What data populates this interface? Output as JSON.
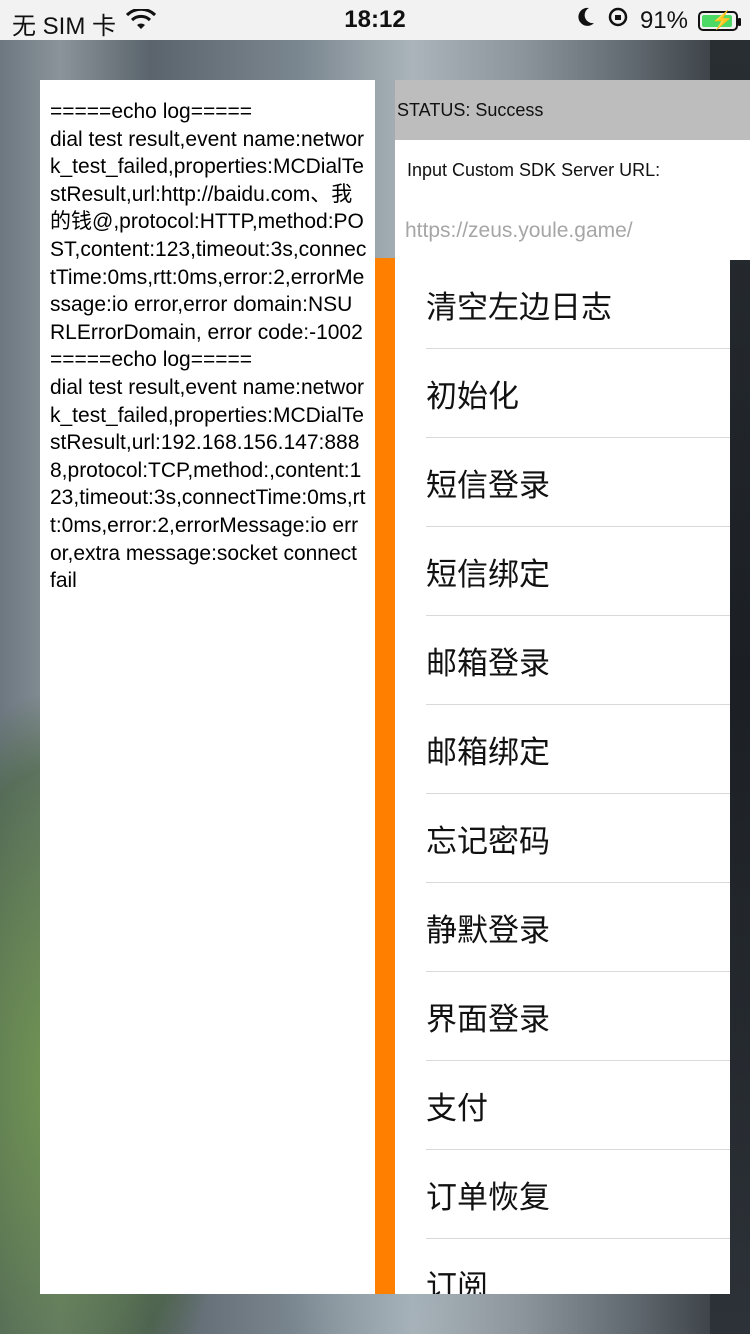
{
  "status_bar": {
    "carrier": "无 SIM 卡",
    "time": "18:12",
    "battery_percent": "91%"
  },
  "log": {
    "text": "=====echo log=====\ndial test result,event name:network_test_failed,properties:MCDialTestResult,url:http://baidu.com、我的钱@,protocol:HTTP,method:POST,content:123,timeout:3s,connectTime:0ms,rtt:0ms,error:2,errorMessage:io error,error domain:NSURLErrorDomain, error code:-1002\n=====echo log=====\ndial test result,event name:network_test_failed,properties:MCDialTestResult,url:192.168.156.147:8888,protocol:TCP,method:,content:123,timeout:3s,connectTime:0ms,rtt:0ms,error:2,errorMessage:io error,extra message:socket connect fail"
  },
  "status": {
    "text": "STATUS: Success"
  },
  "server": {
    "label": "Input Custom SDK Server URL:",
    "placeholder": "https://zeus.youle.game/",
    "value": ""
  },
  "menu": {
    "items": [
      {
        "label": "清空左边日志"
      },
      {
        "label": "初始化"
      },
      {
        "label": "短信登录"
      },
      {
        "label": "短信绑定"
      },
      {
        "label": "邮箱登录"
      },
      {
        "label": "邮箱绑定"
      },
      {
        "label": "忘记密码"
      },
      {
        "label": "静默登录"
      },
      {
        "label": "界面登录"
      },
      {
        "label": "支付"
      },
      {
        "label": "订单恢复"
      },
      {
        "label": "订阅"
      }
    ]
  },
  "colors": {
    "accent_orange": "#ff8000",
    "status_gray": "#bdbdbd",
    "battery_green": "#4cd964"
  }
}
